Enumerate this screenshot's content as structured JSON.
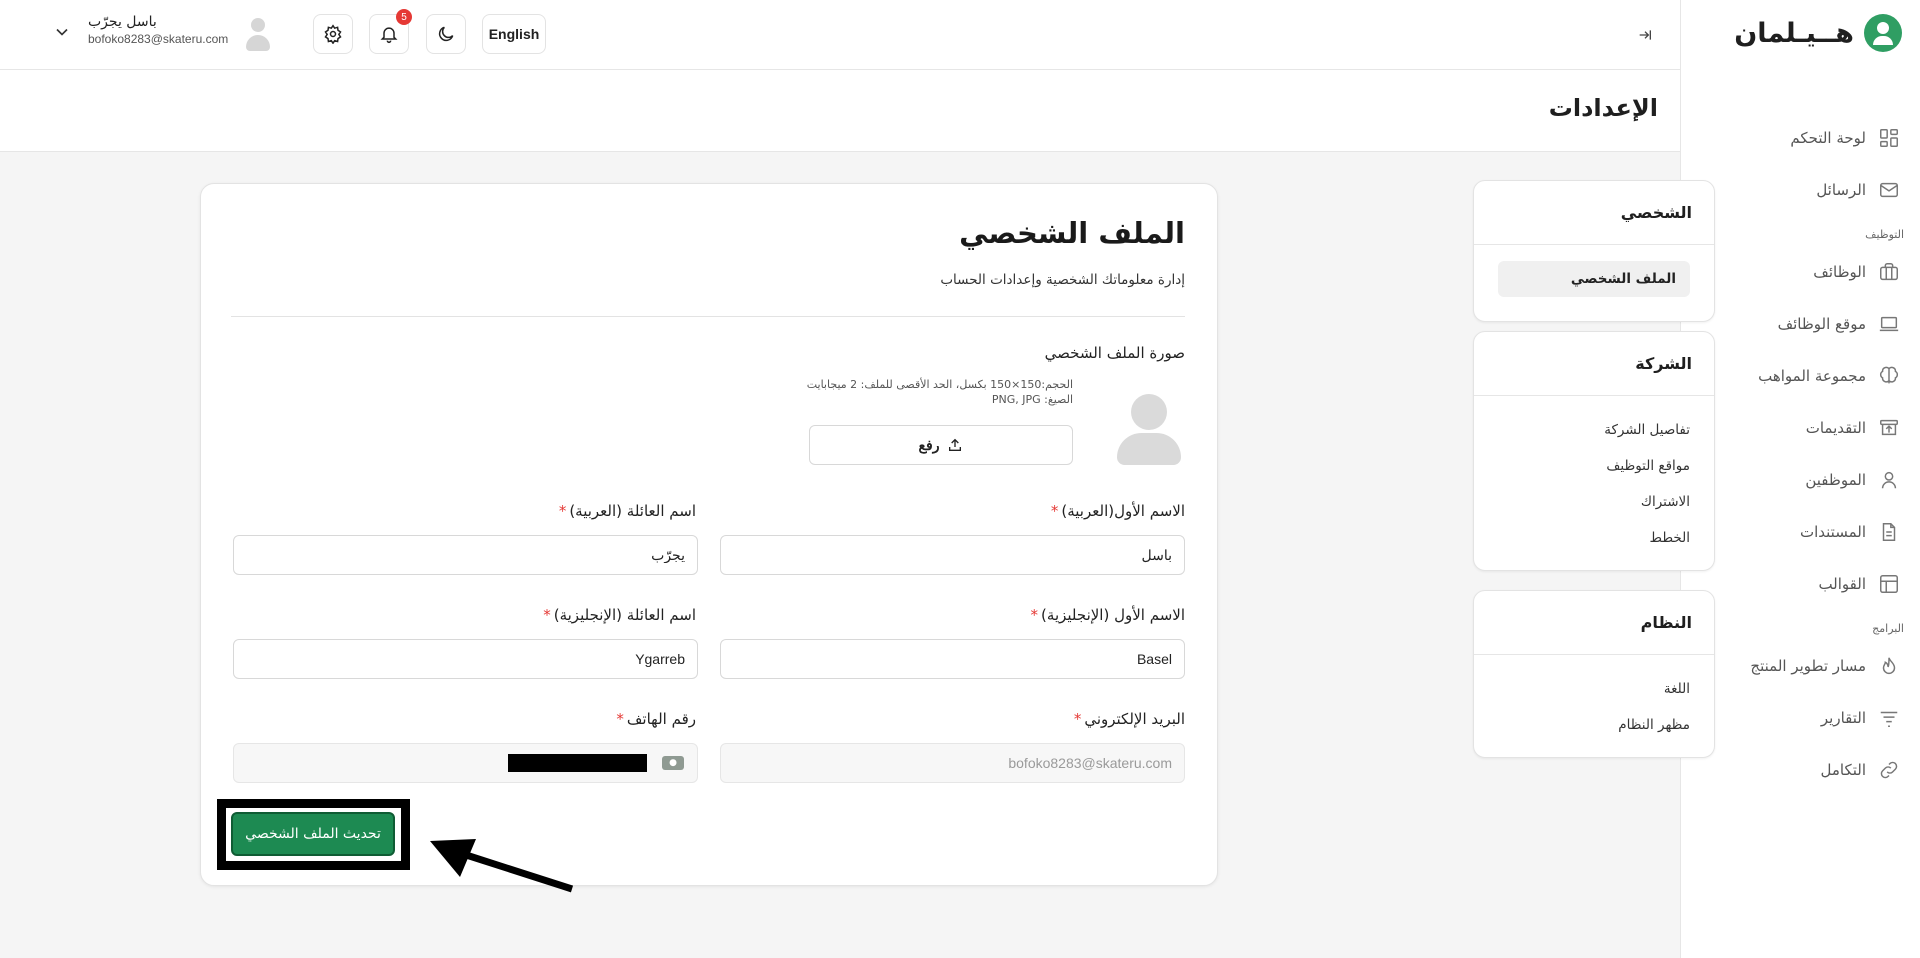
{
  "app": {
    "logo_text": "هــيـلمان",
    "brand_color": "#2f9e63"
  },
  "sidebar": {
    "items": [
      {
        "label": "لوحة التحكم",
        "icon": "dashboard-icon"
      },
      {
        "label": "الرسائل",
        "icon": "mail-icon"
      }
    ],
    "section_hiring": "التوظيف",
    "hiring_items": [
      {
        "label": "الوظائف",
        "icon": "briefcase-icon"
      },
      {
        "label": "موقع الوظائف",
        "icon": "laptop-icon"
      },
      {
        "label": "مجموعة المواهب",
        "icon": "brain-icon"
      },
      {
        "label": "التقديمات",
        "icon": "inbox-icon"
      },
      {
        "label": "الموظفين",
        "icon": "user-icon"
      },
      {
        "label": "المستندات",
        "icon": "document-icon"
      },
      {
        "label": "القوالب",
        "icon": "template-icon"
      }
    ],
    "section_programs": "البرامج",
    "program_items": [
      {
        "label": "مسار تطوير المنتج",
        "icon": "flame-icon"
      },
      {
        "label": "التقارير",
        "icon": "filter-icon"
      },
      {
        "label": "التكامل",
        "icon": "link-icon"
      }
    ]
  },
  "topbar": {
    "language_label": "English",
    "notification_count": "5",
    "user_name": "باسل يجرّب",
    "user_email": "bofoko8283@skateru.com"
  },
  "page": {
    "title": "الإعدادات"
  },
  "settings_menu": {
    "personal": {
      "title": "الشخصي",
      "items": [
        "الملف الشخصي"
      ]
    },
    "company": {
      "title": "الشركة",
      "items": [
        "تفاصيل الشركة",
        "مواقع التوظيف",
        "الاشتراك",
        "الخطط"
      ]
    },
    "system": {
      "title": "النظام",
      "items": [
        "اللغة",
        "مظهر النظام"
      ]
    }
  },
  "profile": {
    "heading": "الملف الشخصي",
    "subheading": "إدارة معلوماتك الشخصية وإعدادات الحساب",
    "photo_label": "صورة الملف الشخصي",
    "photo_hint_size": "الحجم:150×150 بكسل، الحد الأقصى للملف: 2 ميجابايت",
    "photo_hint_formats": "الصيغ: PNG, JPG",
    "upload_label": "رفع",
    "first_name_ar_label": "الاسم الأول(العربية)",
    "first_name_ar_value": "باسل",
    "last_name_ar_label": "اسم العائلة (العربية)",
    "last_name_ar_value": "يجرّب",
    "first_name_en_label": "الاسم الأول (الإنجليزية)",
    "first_name_en_value": "Basel",
    "last_name_en_label": "اسم العائلة (الإنجليزية)",
    "last_name_en_value": "Ygarreb",
    "email_label": "البريد الإلكتروني",
    "email_value": "bofoko8283@skateru.com",
    "phone_label": "رقم الهاتف",
    "required_mark": "*",
    "save_label": "تحديث الملف الشخصي"
  }
}
